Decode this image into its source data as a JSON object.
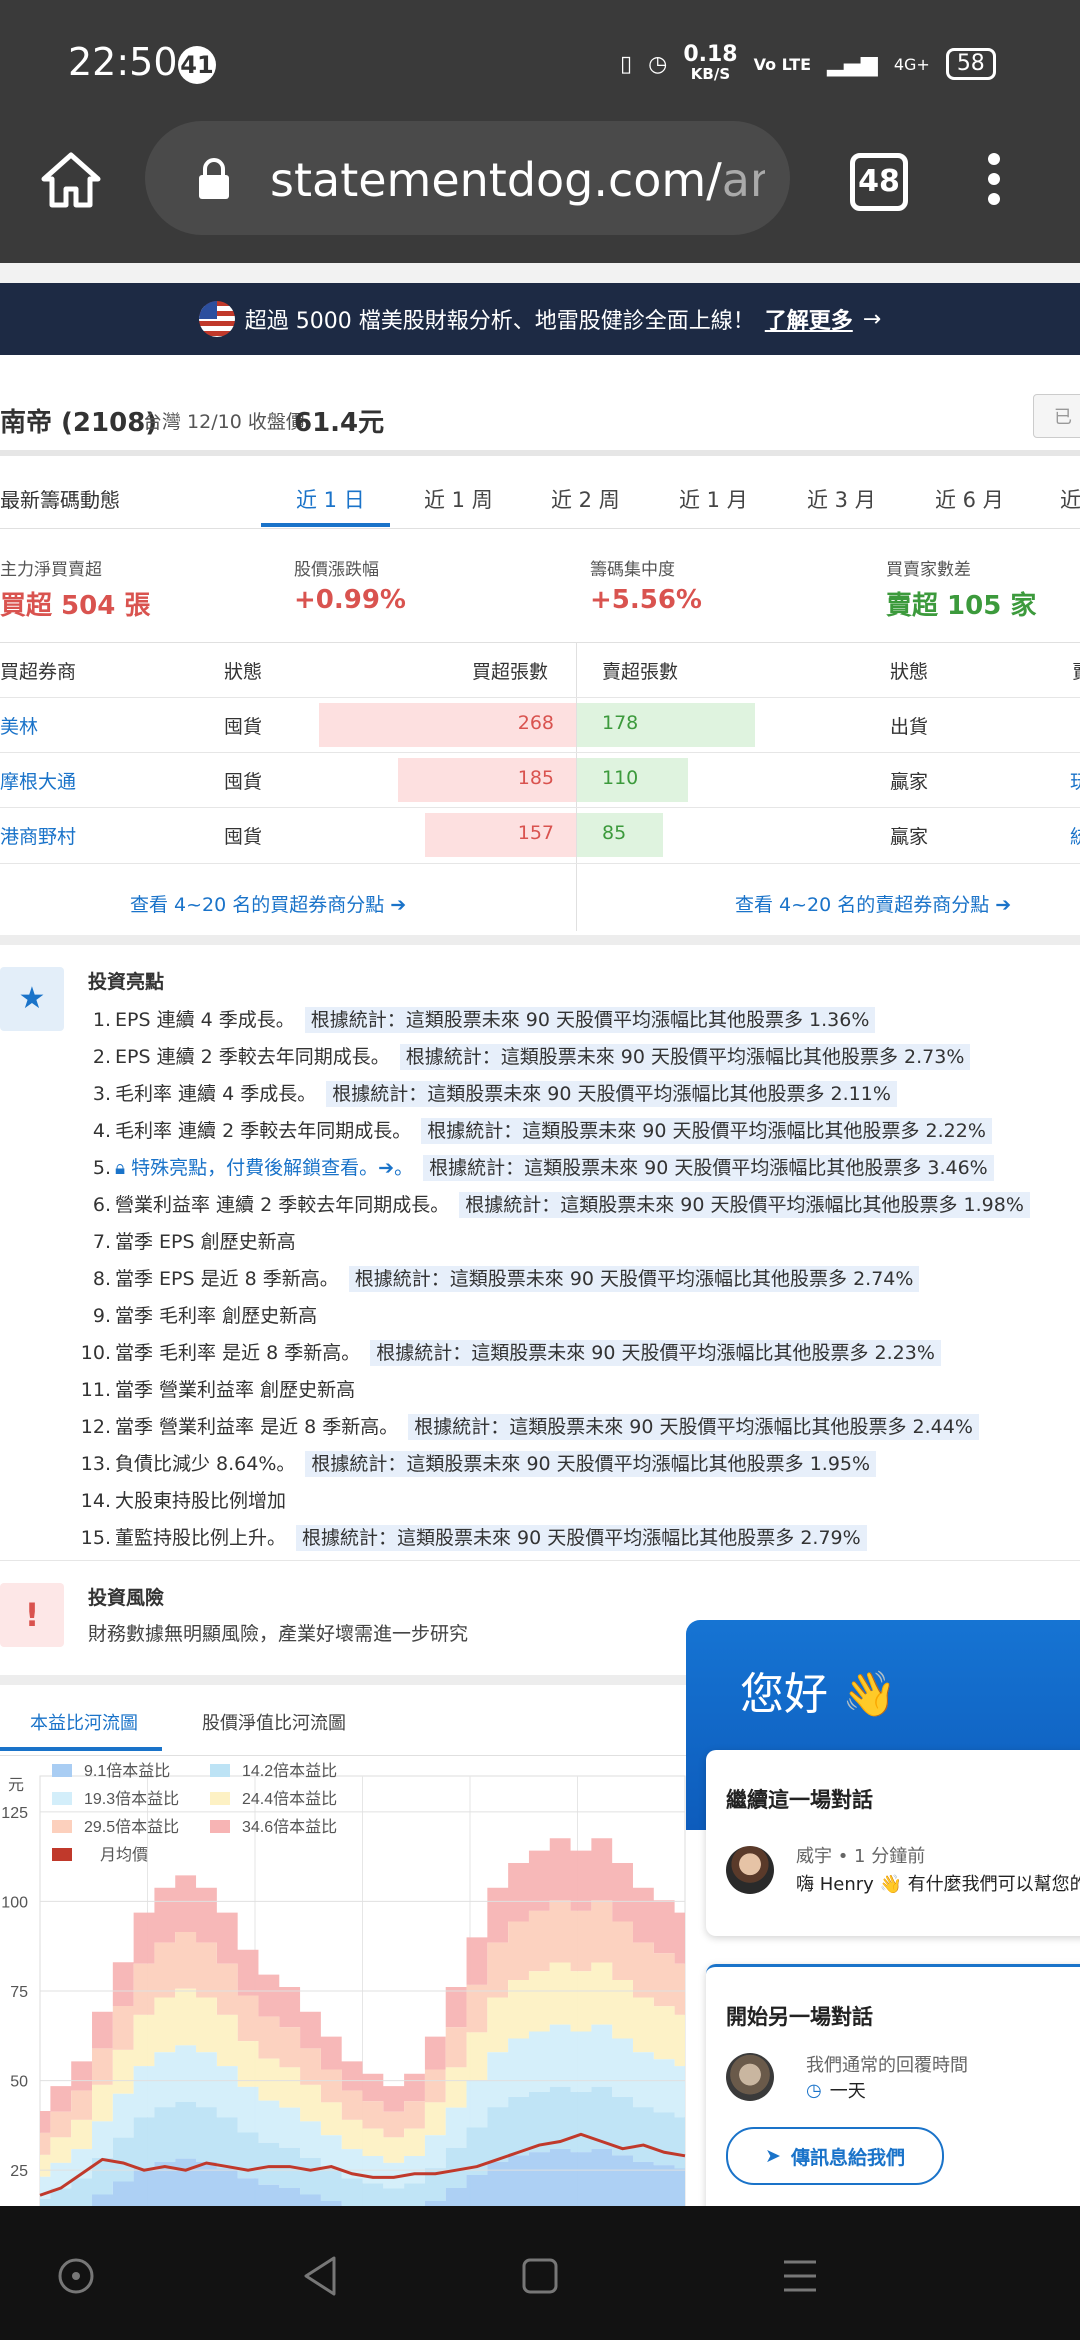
{
  "status": {
    "time": "22:50",
    "badge": "41",
    "speed_top": "0.18",
    "speed_unit": "KB/S",
    "volte": "Vo LTE",
    "net": "4G+",
    "battery": "58"
  },
  "browser": {
    "url_main": "statementdog.com/",
    "url_tail": "ana",
    "tab_count": "48"
  },
  "banner": {
    "text": "超過 5000 檔美股財報分析、地雷股健診全面上線！",
    "link": "了解更多",
    "arrow": "→"
  },
  "stock": {
    "title": "南帝 (2108)",
    "date_label": "台灣 12/10 收盤價",
    "price": "61.4元",
    "button": "已"
  },
  "period": {
    "title": "最新籌碼動態",
    "tabs": [
      "近 1 日",
      "近 1 周",
      "近 2 周",
      "近 1 月",
      "近 3 月",
      "近 6 月",
      "近"
    ]
  },
  "metrics": [
    {
      "label": "主力淨買賣超",
      "value": "買超 504 張",
      "color": "#d9534f"
    },
    {
      "label": "股價漲跌幅",
      "value": "+0.99%",
      "color": "#d9534f"
    },
    {
      "label": "籌碼集中度",
      "value": "+5.56%",
      "color": "#d9534f"
    },
    {
      "label": "買賣家數差",
      "value": "賣超 105 家",
      "color": "#3c9a3c"
    }
  ],
  "broker_table": {
    "headers": {
      "buy_broker": "買超券商",
      "buy_status": "狀態",
      "buy_count": "買超張數",
      "sell_count": "賣超張數",
      "sell_status": "狀態",
      "sell_broker": "賣"
    },
    "rows": [
      {
        "buy_broker": "美林",
        "buy_status": "囤貨",
        "buy_count": "268",
        "buy_frac": 0.95,
        "sell_count": "178",
        "sell_frac": 0.66,
        "sell_status": "出貨",
        "sell_broker": ""
      },
      {
        "buy_broker": "摩根大通",
        "buy_status": "囤貨",
        "buy_count": "185",
        "buy_frac": 0.66,
        "sell_count": "110",
        "sell_frac": 0.41,
        "sell_status": "贏家",
        "sell_broker": "玩"
      },
      {
        "buy_broker": "港商野村",
        "buy_status": "囤貨",
        "buy_count": "157",
        "buy_frac": 0.56,
        "sell_count": "85",
        "sell_frac": 0.32,
        "sell_status": "贏家",
        "sell_broker": "統"
      }
    ],
    "more_buy": "查看 4~20 名的買超券商分點",
    "more_sell": "查看 4~20 名的賣超券商分點"
  },
  "highlights": {
    "title": "投資亮點",
    "items": [
      {
        "n": "1.",
        "text": "EPS 連續 4 季成長。",
        "stat": "根據統計：這類股票未來 90 天股價平均漲幅比其他股票多 1.36%"
      },
      {
        "n": "2.",
        "text": "EPS 連續 2 季較去年同期成長。",
        "stat": "根據統計：這類股票未來 90 天股價平均漲幅比其他股票多 2.73%"
      },
      {
        "n": "3.",
        "text": "毛利率 連續 4 季成長。",
        "stat": "根據統計：這類股票未來 90 天股價平均漲幅比其他股票多 2.11%"
      },
      {
        "n": "4.",
        "text": "毛利率 連續 2 季較去年同期成長。",
        "stat": "根據統計：這類股票未來 90 天股價平均漲幅比其他股票多 2.22%"
      },
      {
        "n": "5.",
        "text": "特殊亮點，付費後解鎖查看。➔。",
        "stat": "根據統計：這類股票未來 90 天股價平均漲幅比其他股票多 3.46%",
        "locked": true
      },
      {
        "n": "6.",
        "text": "營業利益率 連續 2 季較去年同期成長。",
        "stat": "根據統計：這類股票未來 90 天股價平均漲幅比其他股票多 1.98%"
      },
      {
        "n": "7.",
        "text": "當季 EPS 創歷史新高",
        "stat": ""
      },
      {
        "n": "8.",
        "text": "當季 EPS 是近 8 季新高。",
        "stat": "根據統計：這類股票未來 90 天股價平均漲幅比其他股票多 2.74%"
      },
      {
        "n": "9.",
        "text": "當季 毛利率 創歷史新高",
        "stat": ""
      },
      {
        "n": "10.",
        "text": "當季 毛利率 是近 8 季新高。",
        "stat": "根據統計：這類股票未來 90 天股價平均漲幅比其他股票多 2.23%"
      },
      {
        "n": "11.",
        "text": "當季 營業利益率 創歷史新高",
        "stat": ""
      },
      {
        "n": "12.",
        "text": "當季 營業利益率 是近 8 季新高。",
        "stat": "根據統計：這類股票未來 90 天股價平均漲幅比其他股票多 2.44%"
      },
      {
        "n": "13.",
        "text": "負債比減少 8.64%。",
        "stat": "根據統計：這類股票未來 90 天股價平均漲幅比其他股票多 1.95%"
      },
      {
        "n": "14.",
        "text": "大股東持股比例增加",
        "stat": ""
      },
      {
        "n": "15.",
        "text": "董監持股比例上升。",
        "stat": "根據統計：這類股票未來 90 天股價平均漲幅比其他股票多 2.79%"
      }
    ]
  },
  "risk": {
    "title": "投資風險",
    "text": "財務數據無明顯風險，產業好壞需進一步研究"
  },
  "chart_tabs": [
    "本益比河流圖",
    "股價淨值比河流圖"
  ],
  "chart_data": {
    "type": "area",
    "ylabel": "元",
    "ylim": [
      15,
      135
    ],
    "yticks": [
      25,
      50,
      75,
      100,
      125
    ],
    "legend": [
      "9.1倍本益比",
      "14.2倍本益比",
      "19.3倍本益比",
      "24.4倍本益比",
      "29.5倍本益比",
      "34.6倍本益比",
      "月均價"
    ],
    "colors": [
      "#a9cdf3",
      "#bde3f5",
      "#d3eefa",
      "#fdf1c4",
      "#fcd0bd",
      "#f7b4b4",
      "#c0392b"
    ],
    "band_multiples": [
      9.1,
      14.2,
      19.3,
      24.4,
      29.5,
      34.6
    ],
    "eps": [
      1.2,
      1.4,
      1.6,
      2.0,
      2.4,
      2.8,
      3.0,
      3.1,
      3.0,
      2.8,
      2.5,
      2.3,
      2.2,
      2.0,
      1.8,
      1.6,
      1.5,
      1.4,
      1.5,
      1.8,
      2.2,
      2.6,
      3.0,
      3.2,
      3.3,
      3.4,
      3.3,
      3.4,
      3.2,
      3.0,
      2.9,
      2.8
    ],
    "price": [
      18,
      20,
      24,
      28,
      27,
      25,
      26,
      25,
      27,
      26,
      25,
      26,
      26,
      25,
      26,
      24,
      23,
      23,
      24,
      24,
      25,
      26,
      28,
      30,
      32,
      33,
      35,
      33,
      31,
      32,
      30,
      29
    ]
  },
  "chat": {
    "greeting": "您好 👋",
    "continue_title": "繼續這一場對話",
    "agent_line": "威宇 • 1 分鐘前",
    "message": "嗨 Henry 👋 有什麼我們可以幫您的",
    "new_title": "開始另一場對話",
    "reply_label": "我們通常的回覆時間",
    "reply_time": "一天",
    "send_button": "傳訊息給我們"
  }
}
